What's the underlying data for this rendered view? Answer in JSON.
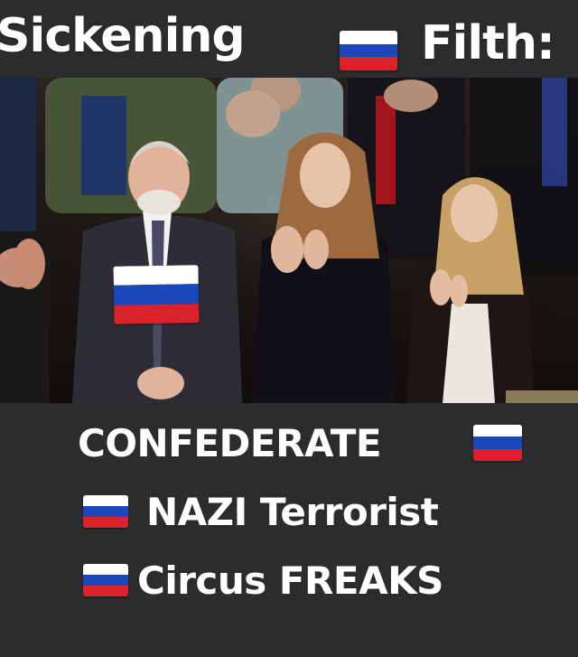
{
  "headline": {
    "word1": "Sickening",
    "word2": "Filth:"
  },
  "caption": {
    "line1": "CONFEDERATE",
    "line2": "NAZI Terrorist",
    "line3": "Circus FREAKS"
  },
  "icons": {
    "flag": "russia-flag-emoji"
  },
  "colors": {
    "background": "#2b2c2e",
    "text": "#ffffff",
    "flag_white": "#ffffff",
    "flag_blue": "#1b48b9",
    "flag_red": "#d9222a"
  }
}
